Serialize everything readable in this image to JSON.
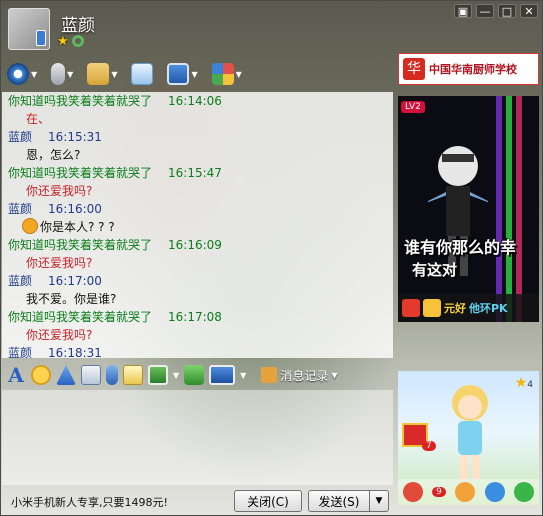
{
  "window": {
    "contact_name": "蓝颜",
    "controls": {
      "skin": "▣",
      "minimize": "—",
      "maximize": "□",
      "close": "✕"
    }
  },
  "chat": {
    "messages": [
      {
        "sender": "你知道吗我笑着笑着就哭了",
        "time": "16:14:06",
        "text": "在、",
        "kind": "other"
      },
      {
        "sender": "蓝颜",
        "time": "16:15:31",
        "text": "恩，怎么?",
        "kind": "me"
      },
      {
        "sender": "你知道吗我笑着笑着就哭了",
        "time": "16:15:47",
        "text": "你还爱我吗?",
        "kind": "other"
      },
      {
        "sender": "蓝颜",
        "time": "16:16:00",
        "text": "你是本人? ? ?",
        "kind": "me",
        "emoji": true
      },
      {
        "sender": "你知道吗我笑着笑着就哭了",
        "time": "16:16:09",
        "text": "你还爱我吗?",
        "kind": "other"
      },
      {
        "sender": "蓝颜",
        "time": "16:17:00",
        "text": "我不爱。你是谁?",
        "kind": "me"
      },
      {
        "sender": "你知道吗我笑着笑着就哭了",
        "time": "16:17:08",
        "text": "你还爱我吗?",
        "kind": "other"
      },
      {
        "sender": "蓝颜",
        "time": "16:18:31",
        "text": "",
        "kind": "me"
      }
    ]
  },
  "toolbar": {
    "message_record": "消息记录"
  },
  "ad": {
    "top_logo": "华",
    "top_text": "中国华南厨师学校",
    "bottom_link": "小米手机新人专享,只要1498元!"
  },
  "show": {
    "lv": "LV2",
    "caption1": "谁有你那么的幸",
    "caption2": "有这对",
    "bar_label": "元好",
    "bar_pk": "他环PK"
  },
  "game": {
    "gift_badge": "7",
    "level_badge": "9",
    "star_badge": "4"
  },
  "buttons": {
    "close": "关闭(C)",
    "send": "发送(S)",
    "send_arrow": "▼"
  },
  "colors": {
    "other_sender": "#0d7d1b",
    "me_sender": "#1f3b8f",
    "quoted_body": "#c8232a"
  }
}
